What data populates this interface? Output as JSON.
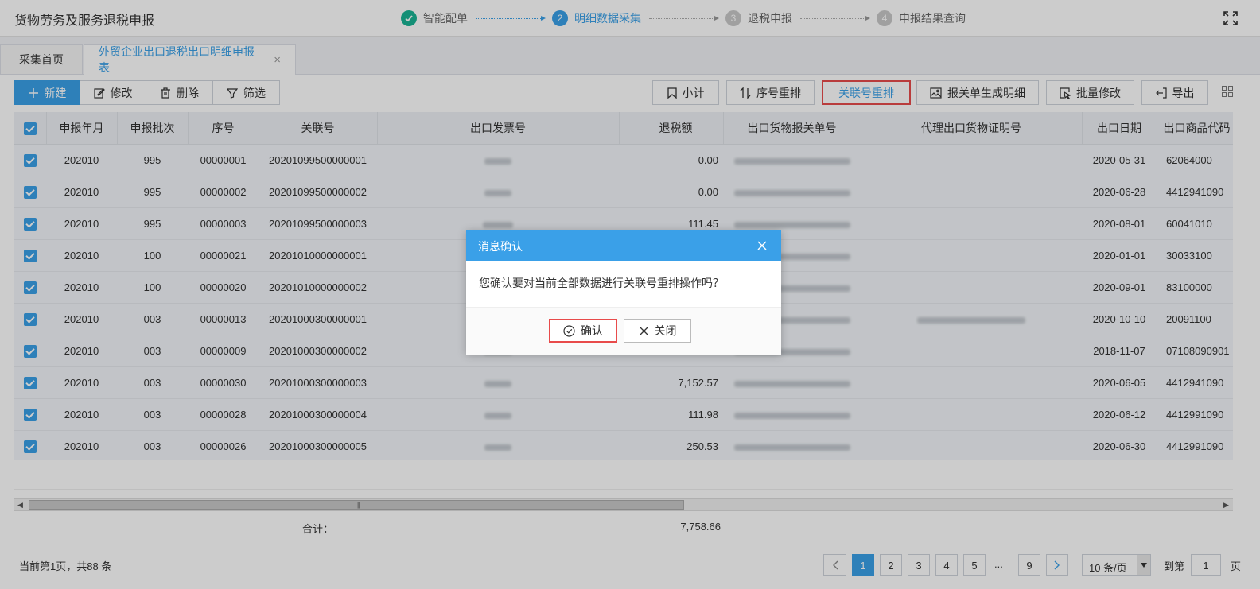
{
  "app": {
    "title": "货物劳务及服务退税申报"
  },
  "steps": [
    {
      "num": "1",
      "label": "智能配单",
      "state": "done"
    },
    {
      "num": "2",
      "label": "明细数据采集",
      "state": "active"
    },
    {
      "num": "3",
      "label": "退税申报",
      "state": "pending"
    },
    {
      "num": "4",
      "label": "申报结果查询",
      "state": "pending"
    }
  ],
  "tabs": [
    {
      "label": "采集首页"
    },
    {
      "label": "外贸企业出口退税出口明细申报表",
      "close": "×"
    }
  ],
  "toolbar": {
    "left": [
      {
        "label": "新建",
        "icon": "plus-icon"
      },
      {
        "label": "修改",
        "icon": "edit-icon"
      },
      {
        "label": "删除",
        "icon": "trash-icon"
      },
      {
        "label": "筛选",
        "icon": "filter-icon"
      }
    ],
    "right": [
      {
        "label": "小计",
        "icon": "bookmark-icon"
      },
      {
        "label": "序号重排",
        "icon": "sort-icon"
      },
      {
        "label": "关联号重排",
        "icon": ""
      },
      {
        "label": "报关单生成明细",
        "icon": "image-icon"
      },
      {
        "label": "批量修改",
        "icon": "batch-edit-icon"
      },
      {
        "label": "导出",
        "icon": "export-icon"
      }
    ]
  },
  "table": {
    "headers": [
      "申报年月",
      "申报批次",
      "序号",
      "关联号",
      "出口发票号",
      "退税额",
      "出口货物报关单号",
      "代理出口货物证明号",
      "出口日期",
      "出口商品代码"
    ],
    "rows": [
      {
        "ym": "202010",
        "batch": "995",
        "seq": "00000001",
        "link": "20201099500000001",
        "amount": "0.00",
        "date": "2020-05-31",
        "code": "62064000"
      },
      {
        "ym": "202010",
        "batch": "995",
        "seq": "00000002",
        "link": "20201099500000002",
        "amount": "0.00",
        "date": "2020-06-28",
        "code": "4412941090"
      },
      {
        "ym": "202010",
        "batch": "995",
        "seq": "00000003",
        "link": "20201099500000003",
        "amount": "111.45",
        "date": "2020-08-01",
        "code": "60041010"
      },
      {
        "ym": "202010",
        "batch": "100",
        "seq": "00000021",
        "link": "20201010000000001",
        "amount": "",
        "date": "2020-01-01",
        "code": "30033100"
      },
      {
        "ym": "202010",
        "batch": "100",
        "seq": "00000020",
        "link": "20201010000000002",
        "amount": "",
        "date": "2020-09-01",
        "code": "83100000"
      },
      {
        "ym": "202010",
        "batch": "003",
        "seq": "00000013",
        "link": "20201000300000001",
        "amount": "",
        "date": "2020-10-10",
        "code": "20091100"
      },
      {
        "ym": "202010",
        "batch": "003",
        "seq": "00000009",
        "link": "20201000300000002",
        "amount": "",
        "date": "2018-11-07",
        "code": "07108090901"
      },
      {
        "ym": "202010",
        "batch": "003",
        "seq": "00000030",
        "link": "20201000300000003",
        "amount": "7,152.57",
        "date": "2020-06-05",
        "code": "4412941090"
      },
      {
        "ym": "202010",
        "batch": "003",
        "seq": "00000028",
        "link": "20201000300000004",
        "amount": "111.98",
        "date": "2020-06-12",
        "code": "4412991090"
      },
      {
        "ym": "202010",
        "batch": "003",
        "seq": "00000026",
        "link": "20201000300000005",
        "amount": "250.53",
        "date": "2020-06-30",
        "code": "4412991090"
      }
    ]
  },
  "totals": {
    "label": "合计：",
    "value": "7,758.66"
  },
  "pagination": {
    "info": "当前第1页，共88 条",
    "pages": [
      "1",
      "2",
      "3",
      "4",
      "5"
    ],
    "ellipsis": "...",
    "last": "9",
    "page_size": "10 条/页",
    "goto_label": "到第",
    "goto_value": "1",
    "goto_suffix": "页"
  },
  "dialog": {
    "title": "消息确认",
    "message": "您确认要对当前全部数据进行关联号重排操作吗？",
    "confirm_label": "确认",
    "cancel_label": "关闭"
  },
  "colors": {
    "accent": "#3aa0e8",
    "done": "#1ab394",
    "highlight": "#e84b4b"
  }
}
